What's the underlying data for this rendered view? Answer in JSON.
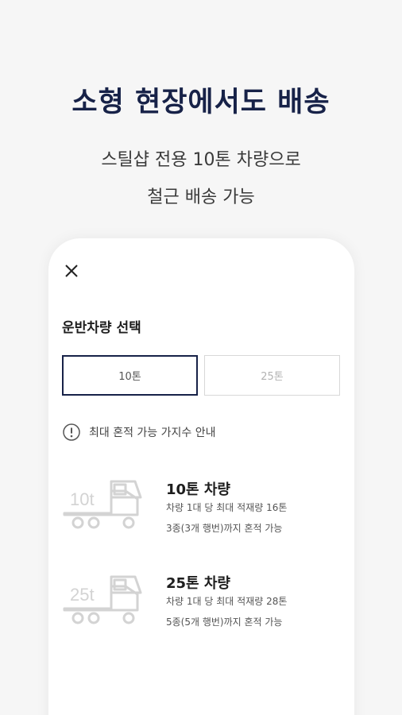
{
  "promo": {
    "headline": "소형 현장에서도 배송",
    "sub_line1": "스틸샵 전용 10톤 차량으로",
    "sub_line2": "철근 배송 가능"
  },
  "modal": {
    "section_title": "운반차량 선택",
    "options": [
      {
        "label": "10톤",
        "selected": true
      },
      {
        "label": "25톤",
        "selected": false
      }
    ],
    "notice": "최대 혼적 가능 가지수 안내",
    "vehicles": [
      {
        "badge": "10t",
        "title": "10톤 차량",
        "line1": "차량 1대 당 최대 적재량 16톤",
        "line2": "3종(3개 행번)까지 혼적 가능"
      },
      {
        "badge": "25t",
        "title": "25톤 차량",
        "line1": "차량 1대 당 최대 적재량 28톤",
        "line2": "5종(5개 행번)까지 혼적 가능"
      }
    ]
  },
  "colors": {
    "accent": "#172248",
    "background": "#f6f6f6",
    "icon_gray": "#d3d3d3"
  },
  "icons": [
    "close-icon",
    "info-icon",
    "truck-icon"
  ]
}
